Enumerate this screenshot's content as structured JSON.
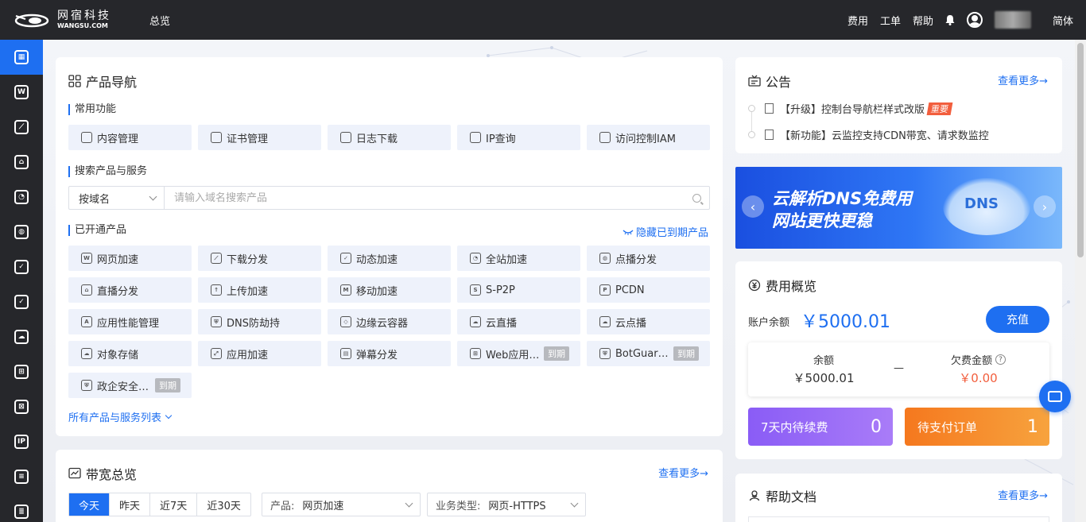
{
  "header": {
    "logo_cn": "网宿科技",
    "logo_en": "WANGSU.COM",
    "nav_overview": "总览",
    "links": [
      "费用",
      "工单",
      "帮助"
    ],
    "language": "简体"
  },
  "sidebar": {
    "items": [
      {
        "name": "overview-grid-icon",
        "glyph": "▦"
      },
      {
        "name": "web-accel-icon",
        "glyph": "W"
      },
      {
        "name": "download-dist-icon",
        "glyph": "⟋"
      },
      {
        "name": "live-icon",
        "glyph": "⌂"
      },
      {
        "name": "dynamic-accel-icon",
        "glyph": "◔"
      },
      {
        "name": "full-site-icon",
        "glyph": "◍"
      },
      {
        "name": "vod-icon",
        "glyph": "✓"
      },
      {
        "name": "check-icon",
        "glyph": "✓"
      },
      {
        "name": "cloud-user-icon",
        "glyph": "☁"
      },
      {
        "name": "waf-icon",
        "glyph": "⊞"
      },
      {
        "name": "edge-icon",
        "glyph": "⊠"
      },
      {
        "name": "ip-icon",
        "glyph": "IP"
      },
      {
        "name": "log-icon",
        "glyph": "≡"
      },
      {
        "name": "cert-icon",
        "glyph": "≣"
      }
    ]
  },
  "nav_card": {
    "title": "产品导航",
    "common_title": "常用功能",
    "common": [
      "内容管理",
      "证书管理",
      "日志下载",
      "IP查询",
      "访问控制IAM"
    ],
    "search_title": "搜索产品与服务",
    "search_select": "按域名",
    "search_placeholder": "请输入域名搜索产品",
    "opened_title": "已开通产品",
    "hide_expired": "隐藏已到期产品",
    "products": [
      {
        "label": "网页加速",
        "icon": "W"
      },
      {
        "label": "下载分发",
        "icon": "⟋"
      },
      {
        "label": "动态加速",
        "icon": "✓"
      },
      {
        "label": "全站加速",
        "icon": "◔"
      },
      {
        "label": "点播分发",
        "icon": "◍"
      },
      {
        "label": "直播分发",
        "icon": "⌂"
      },
      {
        "label": "上传加速",
        "icon": "↑"
      },
      {
        "label": "移动加速",
        "icon": "M"
      },
      {
        "label": "S-P2P",
        "icon": "S"
      },
      {
        "label": "PCDN",
        "icon": "P"
      },
      {
        "label": "应用性能管理",
        "icon": "A"
      },
      {
        "label": "DNS防劫持",
        "icon": "⛨"
      },
      {
        "label": "边缘云容器",
        "icon": "◇"
      },
      {
        "label": "云直播",
        "icon": "☁"
      },
      {
        "label": "云点播",
        "icon": "☁"
      },
      {
        "label": "对象存储",
        "icon": "☁"
      },
      {
        "label": "应用加速",
        "icon": "⤢"
      },
      {
        "label": "弹幕分发",
        "icon": "▤"
      },
      {
        "label": "Web应用…",
        "icon": "⊞",
        "tag": "到期"
      },
      {
        "label": "BotGuar…",
        "icon": "⛨",
        "tag": "到期"
      },
      {
        "label": "政企安全…",
        "icon": "⛨",
        "tag": "到期"
      }
    ],
    "all_products": "所有产品与服务列表"
  },
  "bandwidth": {
    "title": "带宽总览",
    "more": "查看更多→",
    "tabs": [
      "今天",
      "昨天",
      "近7天",
      "近30天"
    ],
    "product_label": "产品:",
    "product_value": "网页加速",
    "biz_label": "业务类型:",
    "biz_value": "网页-HTTPS"
  },
  "notice": {
    "title": "公告",
    "more": "查看更多→",
    "items": [
      {
        "text": "【升级】控制台导航栏样式改版",
        "tag": "重要"
      },
      {
        "text": "【新功能】云监控支持CDN带宽、请求数监控",
        "tag": ""
      }
    ]
  },
  "banner": {
    "line1": "云解析DNS免费用",
    "line2": "网站更快更稳",
    "cloud_text": "DNS"
  },
  "fees": {
    "title": "费用概览",
    "balance_label": "账户余额",
    "balance": "￥5000.01",
    "recharge": "充值",
    "remain_label": "余额",
    "remain_value": "￥5000.01",
    "separator": "—",
    "owed_label": "欠费金额",
    "owed_value": "￥0.00",
    "renew_label": "7天内待续费",
    "renew_count": "0",
    "unpaid_label": "待支付订单",
    "unpaid_count": "1"
  },
  "help": {
    "title": "帮助文档",
    "more": "查看更多→"
  },
  "colors": {
    "accent": "#1e6ff1",
    "topbar": "#26272b",
    "danger": "#f25e3d",
    "renew_gradient": [
      "#8a5cf6",
      "#a97cf8"
    ],
    "unpaid_gradient": [
      "#f5781e",
      "#f7a33e"
    ]
  }
}
